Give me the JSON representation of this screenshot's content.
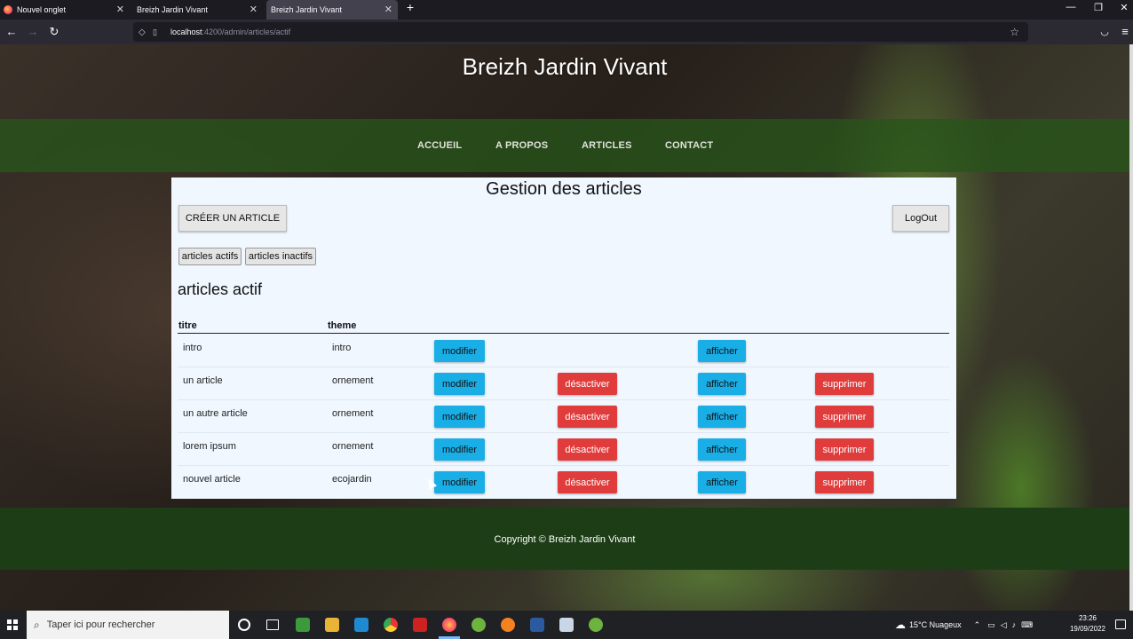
{
  "browser": {
    "tabs": [
      {
        "title": "Nouvel onglet"
      },
      {
        "title": "Breizh Jardin Vivant"
      },
      {
        "title": "Breizh Jardin Vivant"
      }
    ],
    "url_host": "localhost",
    "url_path": ":4200/admin/articles/actif"
  },
  "site": {
    "title": "Breizh Jardin Vivant",
    "menu": [
      "ACCUEIL",
      "A PROPOS",
      "ARTICLES",
      "CONTACT"
    ]
  },
  "panel": {
    "title": "Gestion des articles",
    "create_label": "CRÉER UN ARTICLE",
    "logout_label": "LogOut",
    "filter_active": "articles actifs",
    "filter_inactive": "articles inactifs",
    "list_title": "articles actif",
    "col_title": "titre",
    "col_theme": "theme"
  },
  "rows": [
    {
      "titre": "intro",
      "theme": "intro",
      "modifier": "modifier",
      "desactiver": "",
      "afficher": "afficher",
      "supprimer": ""
    },
    {
      "titre": "un article",
      "theme": "ornement",
      "modifier": "modifier",
      "desactiver": "désactiver",
      "afficher": "afficher",
      "supprimer": "supprimer"
    },
    {
      "titre": "un autre article",
      "theme": "ornement",
      "modifier": "modifier",
      "desactiver": "désactiver",
      "afficher": "afficher",
      "supprimer": "supprimer"
    },
    {
      "titre": "lorem ipsum",
      "theme": "ornement",
      "modifier": "modifier",
      "desactiver": "désactiver",
      "afficher": "afficher",
      "supprimer": "supprimer"
    },
    {
      "titre": "nouvel article",
      "theme": "ecojardin",
      "modifier": "modifier",
      "desactiver": "désactiver",
      "afficher": "afficher",
      "supprimer": "supprimer"
    }
  ],
  "footer": {
    "text": "Copyright © Breizh Jardin Vivant"
  },
  "taskbar": {
    "search_placeholder": "Taper ici pour rechercher",
    "weather": "15°C  Nuageux",
    "time": "23:26",
    "date": "19/09/2022"
  },
  "colors": {
    "menu_bg": "#28551a",
    "footer_bg": "#1d3d17",
    "btn_blue": "#1aaee6",
    "btn_red": "#e03c3c",
    "panel_bg": "#f0f7ff"
  }
}
